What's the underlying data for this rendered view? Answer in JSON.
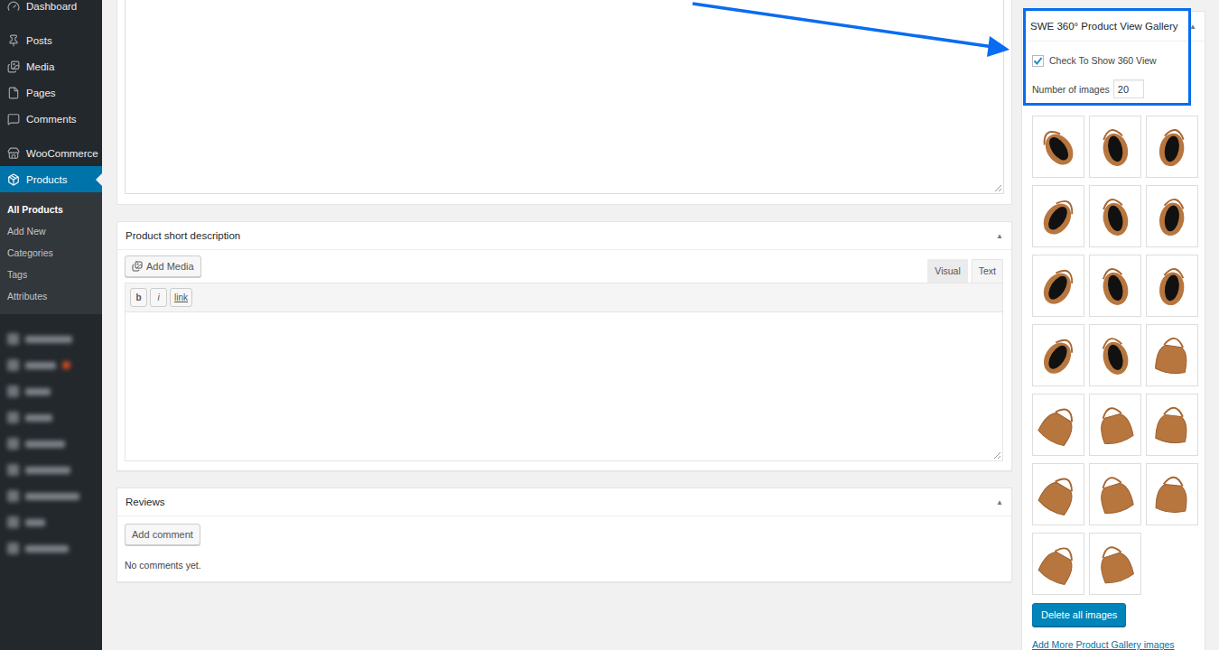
{
  "sidebar": {
    "items": [
      {
        "label": "Dashboard",
        "selected": false
      },
      {
        "label": "Posts",
        "selected": false
      },
      {
        "label": "Media",
        "selected": false
      },
      {
        "label": "Pages",
        "selected": false
      },
      {
        "label": "Comments",
        "selected": false
      },
      {
        "label": "WooCommerce",
        "selected": false
      },
      {
        "label": "Products",
        "selected": true
      }
    ],
    "submenu": [
      {
        "label": "All Products",
        "selected": true
      },
      {
        "label": "Add New",
        "selected": false
      },
      {
        "label": "Categories",
        "selected": false
      },
      {
        "label": "Tags",
        "selected": false
      },
      {
        "label": "Attributes",
        "selected": false
      }
    ],
    "blurred_items": [
      {
        "badge": false
      },
      {
        "badge": true
      },
      {
        "badge": false
      },
      {
        "badge": false
      },
      {
        "badge": false
      },
      {
        "badge": false
      },
      {
        "badge": false
      },
      {
        "badge": false
      },
      {
        "badge": false
      }
    ]
  },
  "short_description": {
    "title": "Product short description",
    "toggle": "▲",
    "add_media": "Add Media",
    "tabs": [
      {
        "label": "Visual",
        "selected": false
      },
      {
        "label": "Text",
        "selected": true
      }
    ],
    "quicktags": [
      {
        "label": "b",
        "kind": "bold"
      },
      {
        "label": "i",
        "kind": "italic"
      },
      {
        "label": "link",
        "kind": "link"
      }
    ]
  },
  "reviews": {
    "title": "Reviews",
    "toggle": "▲",
    "button": "Add comment",
    "empty": "No comments yet."
  },
  "gallery": {
    "title": "SWE 360° Product View Gallery",
    "toggle": "▲",
    "show_360": {
      "label": "Check To Show 360 View",
      "checked": true
    },
    "number_of_images": {
      "label": "Number of images",
      "value": "20"
    },
    "thumbnails": [
      {
        "kind": "open"
      },
      {
        "kind": "open"
      },
      {
        "kind": "open"
      },
      {
        "kind": "open"
      },
      {
        "kind": "open"
      },
      {
        "kind": "open"
      },
      {
        "kind": "open"
      },
      {
        "kind": "open"
      },
      {
        "kind": "open"
      },
      {
        "kind": "open"
      },
      {
        "kind": "open"
      },
      {
        "kind": "closed"
      },
      {
        "kind": "closed"
      },
      {
        "kind": "closed"
      },
      {
        "kind": "closed"
      },
      {
        "kind": "closed"
      },
      {
        "kind": "closed"
      },
      {
        "kind": "closed"
      },
      {
        "kind": "closed"
      },
      {
        "kind": "closed"
      }
    ],
    "delete_button": "Delete all images",
    "add_more_link": "Add More Product Gallery images"
  }
}
